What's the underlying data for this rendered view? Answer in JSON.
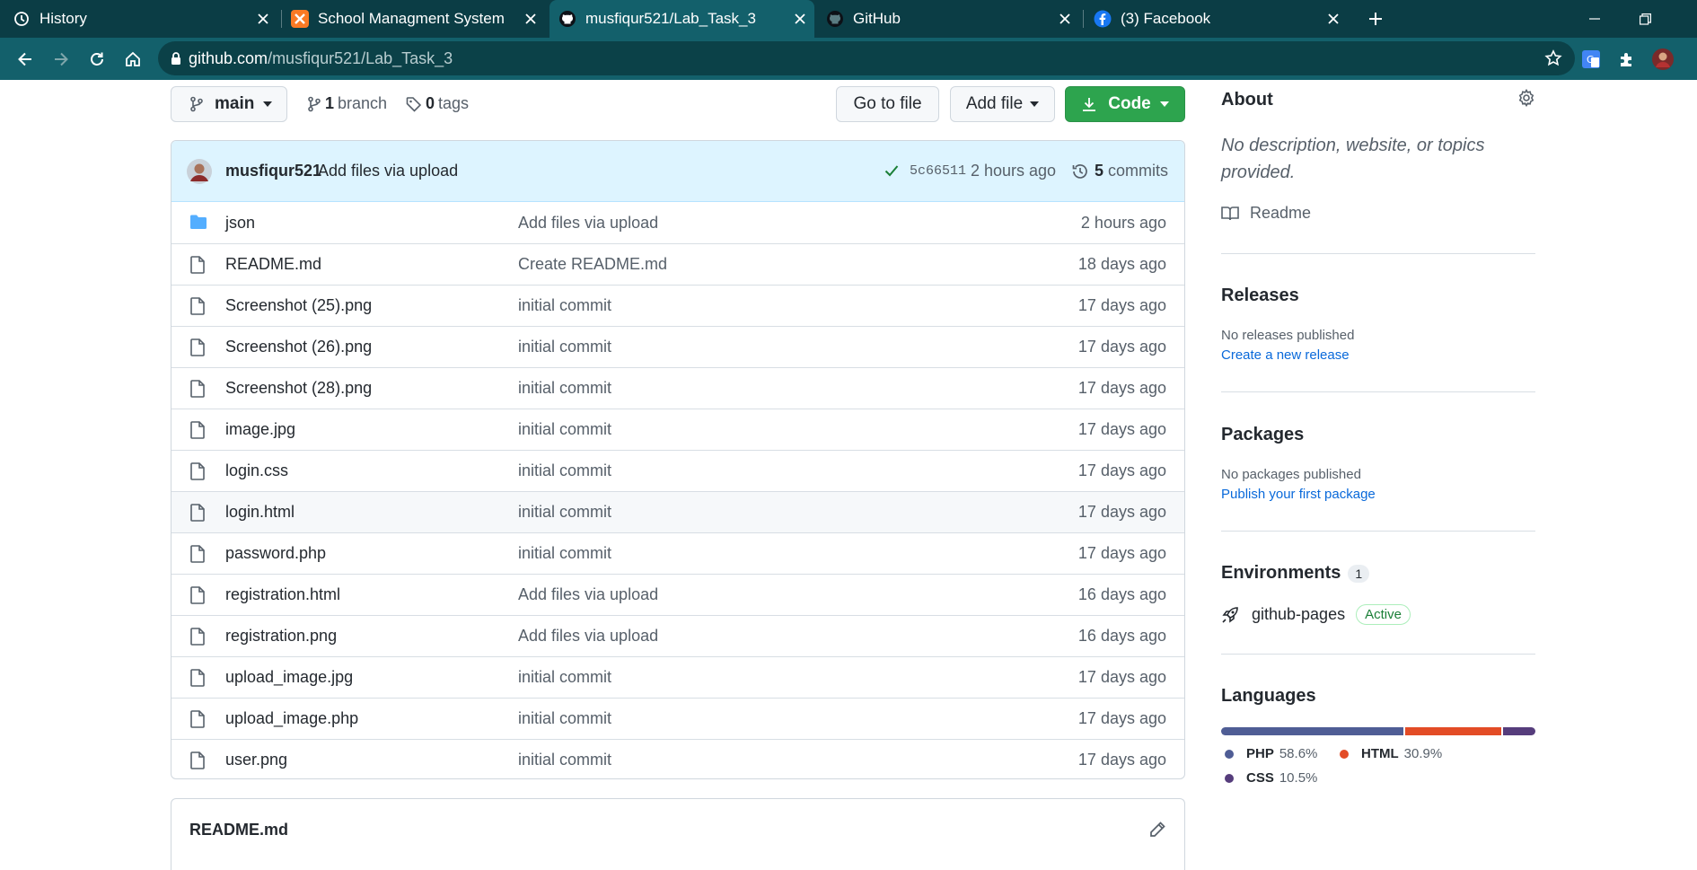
{
  "browser": {
    "tabs": [
      {
        "title": "History",
        "favicon": "history-icon"
      },
      {
        "title": "School Managment System",
        "favicon": "xampp-icon"
      },
      {
        "title": "musfiqur521/Lab_Task_3",
        "favicon": "github-icon",
        "active": true
      },
      {
        "title": "GitHub",
        "favicon": "github-icon"
      },
      {
        "title": "(3) Facebook",
        "favicon": "facebook-icon"
      }
    ],
    "url_domain": "github.com",
    "url_path": "/musfiqur521/Lab_Task_3"
  },
  "repo": {
    "branch_button": "main",
    "branches_count": "1",
    "branches_label": "branch",
    "tags_count": "0",
    "tags_label": "tags",
    "go_to_file": "Go to file",
    "add_file": "Add file",
    "code": "Code"
  },
  "commit": {
    "author": "musfiqur521",
    "message": "Add files via upload",
    "hash": "5c66511",
    "time": "2 hours ago",
    "commits_count": "5",
    "commits_label": "commits"
  },
  "files": [
    {
      "name": "json",
      "type": "dir",
      "message": "Add files via upload",
      "age": "2 hours ago"
    },
    {
      "name": "README.md",
      "type": "file",
      "message": "Create README.md",
      "age": "18 days ago"
    },
    {
      "name": "Screenshot (25).png",
      "type": "file",
      "message": "initial commit",
      "age": "17 days ago"
    },
    {
      "name": "Screenshot (26).png",
      "type": "file",
      "message": "initial commit",
      "age": "17 days ago"
    },
    {
      "name": "Screenshot (28).png",
      "type": "file",
      "message": "initial commit",
      "age": "17 days ago"
    },
    {
      "name": "image.jpg",
      "type": "file",
      "message": "initial commit",
      "age": "17 days ago"
    },
    {
      "name": "login.css",
      "type": "file",
      "message": "initial commit",
      "age": "17 days ago"
    },
    {
      "name": "login.html",
      "type": "file",
      "message": "initial commit",
      "age": "17 days ago",
      "hovered": true
    },
    {
      "name": "password.php",
      "type": "file",
      "message": "initial commit",
      "age": "17 days ago"
    },
    {
      "name": "registration.html",
      "type": "file",
      "message": "Add files via upload",
      "age": "16 days ago"
    },
    {
      "name": "registration.png",
      "type": "file",
      "message": "Add files via upload",
      "age": "16 days ago"
    },
    {
      "name": "upload_image.jpg",
      "type": "file",
      "message": "initial commit",
      "age": "17 days ago"
    },
    {
      "name": "upload_image.php",
      "type": "file",
      "message": "initial commit",
      "age": "17 days ago"
    },
    {
      "name": "user.png",
      "type": "file",
      "message": "initial commit",
      "age": "17 days ago"
    }
  ],
  "readme": {
    "title": "README.md"
  },
  "about": {
    "heading": "About",
    "description": "No description, website, or topics provided.",
    "readme_link": "Readme"
  },
  "releases": {
    "heading": "Releases",
    "empty": "No releases published",
    "link": "Create a new release"
  },
  "packages": {
    "heading": "Packages",
    "empty": "No packages published",
    "link": "Publish your first package"
  },
  "environments": {
    "heading": "Environments",
    "count": "1",
    "name": "github-pages",
    "status": "Active"
  },
  "languages": {
    "heading": "Languages",
    "items": [
      {
        "name": "PHP",
        "percent": "58.6%",
        "value": 58.6,
        "color": "#4F5D95"
      },
      {
        "name": "HTML",
        "percent": "30.9%",
        "value": 30.9,
        "color": "#e34c26"
      },
      {
        "name": "CSS",
        "percent": "10.5%",
        "value": 10.5,
        "color": "#563d7c"
      }
    ]
  },
  "colors": {
    "chrome_bg": "#0b3d45",
    "toolbar_bg": "#13606b",
    "code_button": "#2da44e",
    "link": "#0969da"
  }
}
